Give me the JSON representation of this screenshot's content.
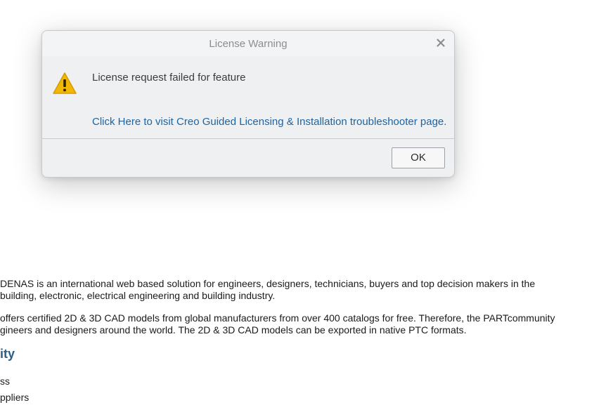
{
  "background": {
    "paragraph1": {
      "line1": "DENAS is an international web based solution for engineers, designers, technicians, buyers and top decision makers in the",
      "line2": "building, electronic, electrical engineering and building industry."
    },
    "paragraph2": {
      "line1": "offers certified 2D & 3D CAD models from global manufacturers from over 400 catalogs for free. Therefore, the PARTcommunity",
      "line2": "gineers and designers around the world. The 2D & 3D CAD models can be exported in native PTC formats."
    },
    "heading": "ity",
    "list": [
      "ss",
      "ppliers"
    ]
  },
  "dialog": {
    "title": "License Warning",
    "close_icon": "close-icon",
    "warning_icon": "warning-icon",
    "message": "License request failed for feature",
    "link_text": "Click Here to visit Creo Guided Licensing & Installation troubleshooter page.",
    "ok_label": "OK"
  },
  "colors": {
    "link": "#1d64a4",
    "heading": "#2c5d85",
    "warning_fill": "#f2b705"
  }
}
